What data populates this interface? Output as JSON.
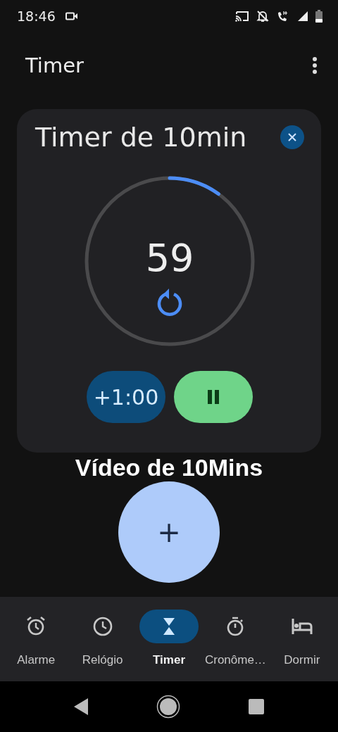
{
  "status_bar": {
    "time": "18:46"
  },
  "app_bar": {
    "title": "Timer"
  },
  "timer_card": {
    "title": "Timer de 10min",
    "remaining": "59",
    "level": 0.1,
    "add_button": "+1:00",
    "running": true
  },
  "caption_overlay": "Vídeo de 10Mins",
  "fab": {
    "label": "+"
  },
  "bottom_nav": [
    {
      "label": "Alarme",
      "kind": "alarm",
      "selected": false
    },
    {
      "label": "Relógio",
      "kind": "clock",
      "selected": false
    },
    {
      "label": "Timer",
      "kind": "hourglass",
      "selected": true
    },
    {
      "label": "Cronôme…",
      "kind": "stopwatch",
      "selected": false
    },
    {
      "label": "Dormir",
      "kind": "bed",
      "selected": false
    }
  ]
}
